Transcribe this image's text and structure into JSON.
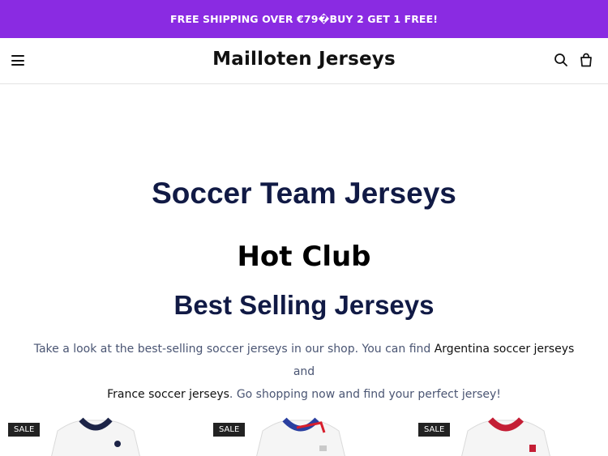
{
  "announcement": {
    "text": "FREE SHIPPING OVER €79�BUY 2 GET 1 FREE!"
  },
  "header": {
    "logo": "Mailloten Jerseys",
    "icons": {
      "menu": "menu-icon",
      "search": "search-icon",
      "bag": "bag-icon"
    }
  },
  "main": {
    "heading_team": "Soccer Team Jerseys",
    "heading_hot": "Hot Club",
    "heading_best": "Best Selling Jerseys",
    "desc": {
      "part1": "Take a look at the best-selling soccer jerseys in our shop. You can find ",
      "link1": "Argentina soccer jerseys",
      "part2": " and ",
      "link2": "France soccer jerseys",
      "part3": ". Go shopping now and find your perfect jersey!"
    }
  },
  "products": [
    {
      "badge": "SALE",
      "collar_color": "#1c2447",
      "accent_color": "#ffffff"
    },
    {
      "badge": "SALE",
      "collar_color": "#2a3fa0",
      "accent_color": "#d81e2c"
    },
    {
      "badge": "SALE",
      "collar_color": "#c41e35",
      "accent_color": "#ffffff"
    }
  ],
  "colors": {
    "announcement_bg": "#8a2be2",
    "heading": "#111a45",
    "body_text": "#4a5573"
  }
}
